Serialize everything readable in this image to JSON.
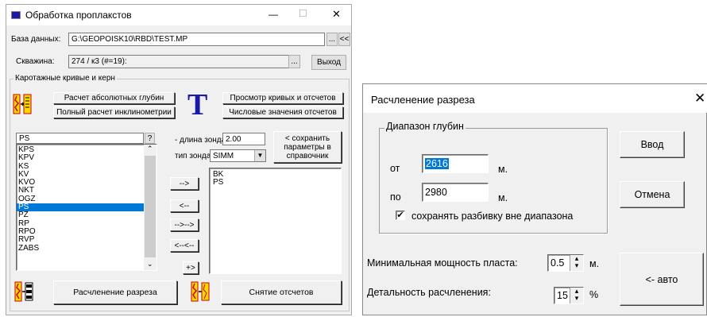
{
  "left_window": {
    "title": "Обработка проплакстов",
    "controls": {
      "minimize": "—",
      "maximize": "☐",
      "close": "✕"
    },
    "db_label": "База данных:",
    "db_path": "G:\\GEOPOISK10\\RBD\\TEST.MP",
    "db_browse": "...",
    "db_back": "<<",
    "well_label": "Скважина:",
    "well_value": "274 / к3 (#=19):",
    "well_browse": "...",
    "exit_button": "Выход",
    "group_title": "Каротажные кривые и керн",
    "btn_abs_depth": "Расчет абсолютных глубин",
    "btn_full_incl": "Полный расчет инклинометрии",
    "btn_view_curves": "Просмотр кривых и отсчетов",
    "btn_numeric": "Числовые значения отсчетов",
    "t_icon": "T",
    "curve_input": "PS",
    "help_btn": "?",
    "curve_list": [
      "KPS",
      "KPV",
      "KS",
      "KV",
      "KVO",
      "NKT",
      "OGZ",
      "PS",
      "PZ",
      "RP",
      "RPO",
      "RVP",
      "ZABS"
    ],
    "selected_curve": "PS",
    "probe_length_label": "- длина зонда:",
    "probe_length_value": "2.00",
    "probe_type_label": "тип зонда:",
    "probe_type_value": "SIMM",
    "save_params": "< сохранить параметры в справочник",
    "move_buttons": [
      "-->",
      "<--",
      "-->-->",
      "<--<--",
      "+>"
    ],
    "chosen_list": [
      "BK",
      "PS"
    ],
    "btn_section": "Расчленение разреза",
    "btn_readings": "Снятие отсчетов",
    "icon_names": [
      "curves-icon",
      "t-icon",
      "section-icon",
      "readings-icon"
    ]
  },
  "right_window": {
    "title": "Расчленение разреза",
    "close": "✕",
    "depth_group": "Диапазон глубин",
    "from_label": "от",
    "from_value": "2616",
    "to_label": "по",
    "to_value": "2980",
    "unit_m": "м.",
    "keep_checkbox": "сохранять разбивку вне диапазона",
    "keep_checked": true,
    "ok_button": "Ввод",
    "cancel_button": "Отмена",
    "min_thickness_label": "Минимальная мощность пласта:",
    "min_thickness_value": "0.5",
    "detail_label": "Детальность расчленения:",
    "detail_value": "15",
    "percent": "%",
    "auto_button": "<- авто"
  },
  "colors": {
    "accent": "#0078d7",
    "window_bg": "#f0f0f0",
    "title_bg": "#ffffff",
    "icon_blue": "#1a1aa6"
  }
}
